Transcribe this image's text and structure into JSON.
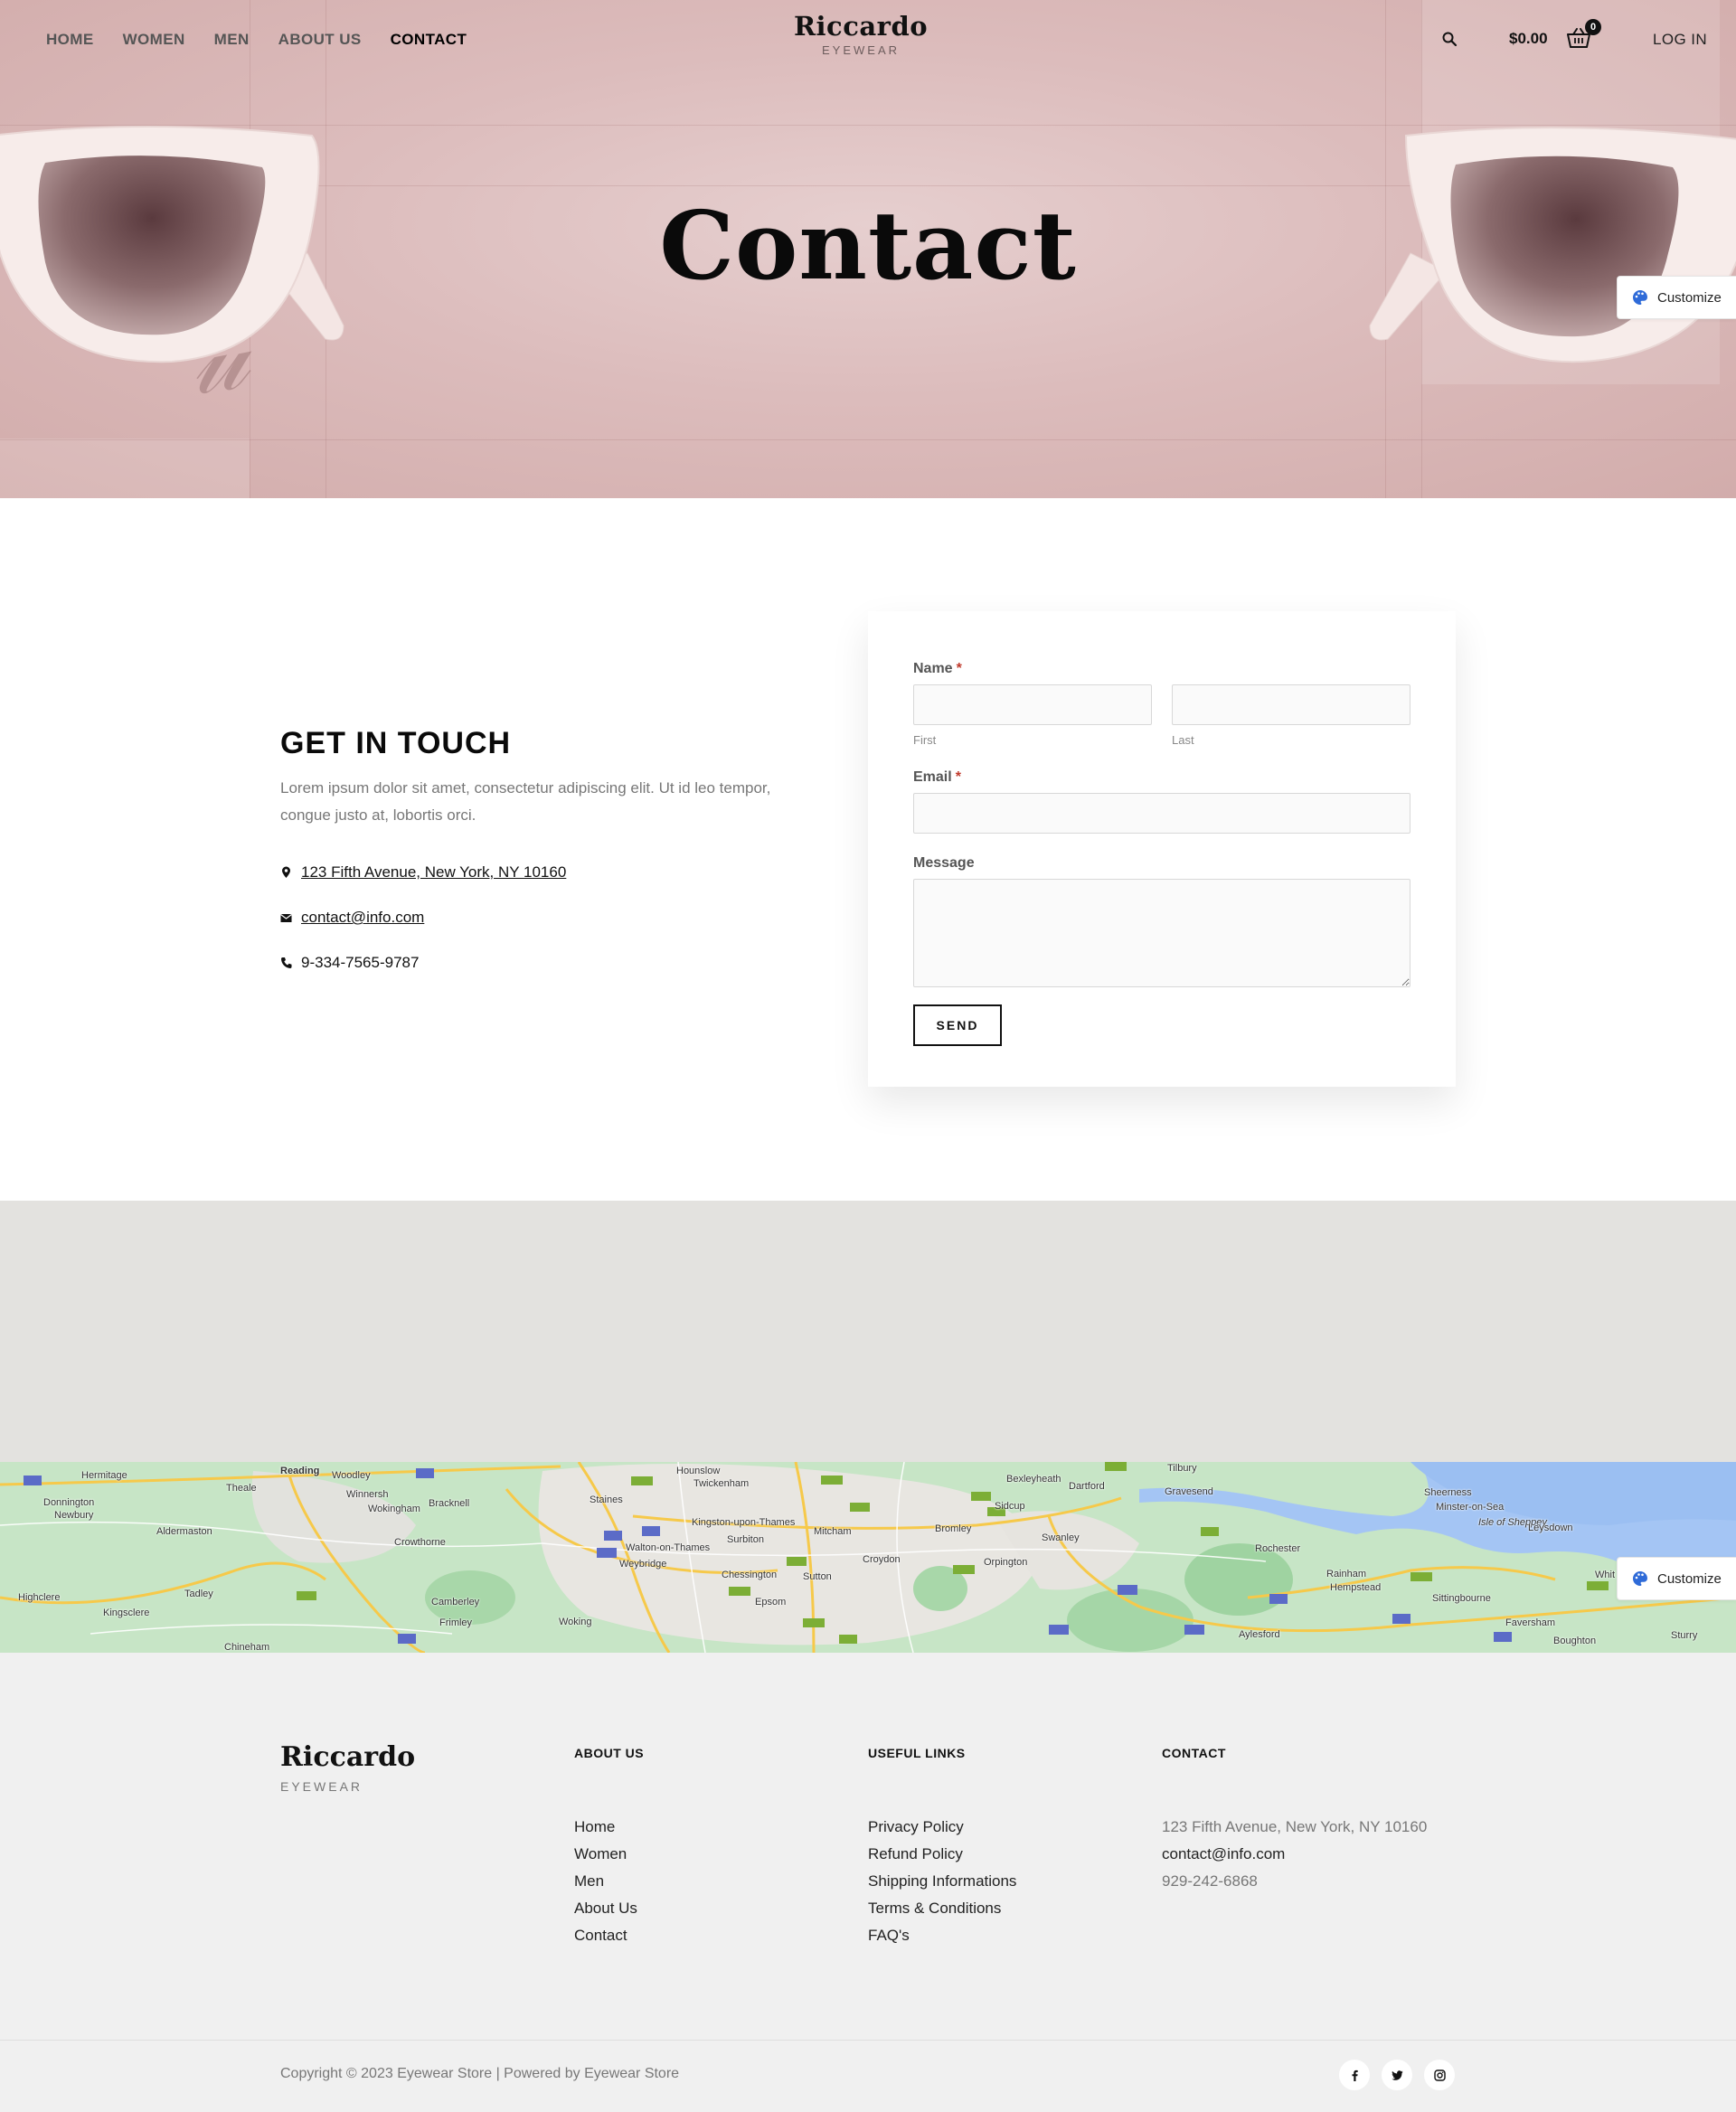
{
  "nav": {
    "links": [
      "HOME",
      "WOMEN",
      "MEN",
      "ABOUT US",
      "CONTACT"
    ],
    "active": "CONTACT",
    "brand_name": "Riccardo",
    "brand_sub": "EYEWEAR",
    "cart_total": "$0.00",
    "cart_count": "0",
    "login": "LOG IN",
    "icons": [
      "search-icon",
      "cart-icon"
    ]
  },
  "hero": {
    "title": "Contact",
    "colors": {
      "background": "#dcbcbc"
    }
  },
  "customize": {
    "label": "Customize"
  },
  "contact": {
    "title": "GET IN TOUCH",
    "text": "Lorem ipsum dolor sit amet, consectetur adipiscing elit. Ut id leo tempor, congue justo at, lobortis orci.",
    "address": "123 Fifth Avenue, New York, NY 10160",
    "email": "contact@info.com",
    "phone": "9-334-7565-9787"
  },
  "form": {
    "name_label": "Name",
    "first_label": "First",
    "last_label": "Last",
    "email_label": "Email",
    "message_label": "Message",
    "required_mark": "*",
    "first_value": "",
    "last_value": "",
    "email_value": "",
    "message_value": "",
    "send_label": "SEND"
  },
  "map": {
    "places": [
      "Hermitage",
      "Reading",
      "Woodley",
      "Theale",
      "Donnington",
      "Newbury",
      "Winnersh",
      "Wokingham",
      "Bracknell",
      "Aldermaston",
      "Crowthorne",
      "Highclere",
      "Tadley",
      "Kingsclere",
      "Camberley",
      "Frimley",
      "Chineham",
      "Woking",
      "Hounslow",
      "Twickenham",
      "Staines",
      "Kingston-upon-Thames",
      "Walton-on-Thames",
      "Surbiton",
      "Weybridge",
      "Chessington",
      "Epsom",
      "Sutton",
      "Mitcham",
      "Croydon",
      "Bromley",
      "Orpington",
      "Sidcup",
      "Bexleyheath",
      "Dartford",
      "Swanley",
      "Tilbury",
      "Gravesend",
      "Rochester",
      "Rainham",
      "Hempstead",
      "Sittingbourne",
      "Aylesford",
      "Sheerness",
      "Minster-on-Sea",
      "Isle of Sheppey",
      "Leysdown",
      "Faversham",
      "Boughton",
      "Sturry",
      "Whit"
    ],
    "colors": {
      "land": "#c8e6c9",
      "water": "#a4c5f4",
      "road": "#f6c94a"
    }
  },
  "footer": {
    "brand_name": "Riccardo",
    "brand_sub": "EYEWEAR",
    "about": {
      "title": "ABOUT US",
      "items": [
        "Home",
        "Women",
        "Men",
        "About Us",
        "Contact"
      ]
    },
    "useful": {
      "title": "USEFUL LINKS",
      "items": [
        "Privacy Policy",
        "Refund Policy",
        "Shipping Informations",
        "Terms & Conditions",
        "FAQ's"
      ]
    },
    "contact": {
      "title": "CONTACT",
      "address": "123 Fifth Avenue, New York, NY 10160",
      "email": "contact@info.com",
      "phone": "929-242-6868"
    },
    "copyright": "Copyright © 2023 Eyewear Store | Powered by Eyewear Store",
    "social": [
      "facebook-icon",
      "twitter-icon",
      "instagram-icon"
    ]
  }
}
